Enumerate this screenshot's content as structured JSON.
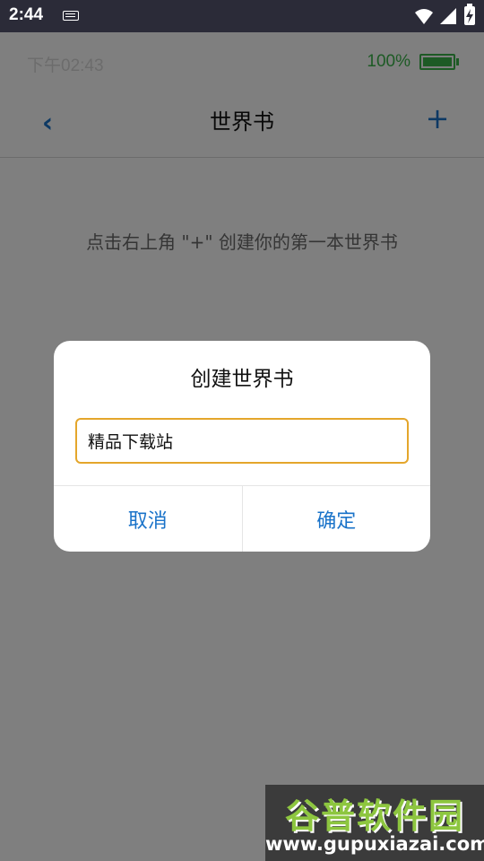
{
  "system_status": {
    "time": "2:44",
    "icons": [
      "keyboard-icon",
      "wifi-icon",
      "signal-icon",
      "battery-charging-icon"
    ]
  },
  "app_status": {
    "time": "下午02:43",
    "battery_percent": "100%",
    "battery_level": 1.0,
    "battery_color": "#3bb54a"
  },
  "navbar": {
    "back_icon": "‹",
    "title": "世界书",
    "add_icon": "+"
  },
  "main": {
    "empty_hint": "点击右上角 \"+\" 创建你的第一本世界书"
  },
  "dialog": {
    "title": "创建世界书",
    "input_value": "精品下载站",
    "cancel_label": "取消",
    "confirm_label": "确定"
  },
  "watermark": {
    "logo_text": "谷普软件园",
    "url": "www.gupuxiazai.com"
  },
  "colors": {
    "accent": "#1a73c9",
    "input_border": "#e4a62b",
    "system_bar": "#2b2b38"
  }
}
